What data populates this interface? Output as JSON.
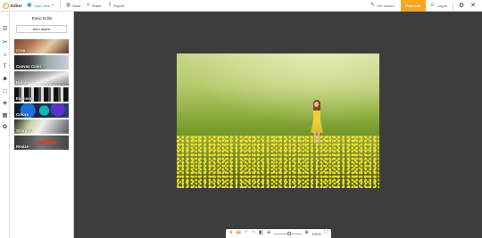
{
  "topbar": {
    "brand": "Editor",
    "open_new": "Open new",
    "save": "Save",
    "share": "Share",
    "export": "Export",
    "get_started": "Get started",
    "free_trial": "Free trial",
    "login": "Log in"
  },
  "panel": {
    "title": "Basic Edits",
    "auto_adjust": "Auto adjust",
    "tiles": [
      {
        "label": "Crop"
      },
      {
        "label": "Canvas Color"
      },
      {
        "label": "Rotate"
      },
      {
        "label": "Exposure"
      },
      {
        "label": "Colors"
      },
      {
        "label": "Sharpen"
      },
      {
        "label": "Resize"
      }
    ]
  },
  "bottombar": {
    "zoom": 100,
    "zoom_label": "100%"
  },
  "colors": {
    "accent": "#f6a623",
    "link": "#2a8fd8",
    "canvas_bg": "#3d3d3d"
  },
  "icons": {
    "rail": [
      "sliders-icon",
      "crop-icon",
      "brush-icon",
      "text-icon",
      "touchup-icon",
      "frame-icon",
      "texture-icon",
      "overlay-icon",
      "stickers-icon"
    ]
  }
}
